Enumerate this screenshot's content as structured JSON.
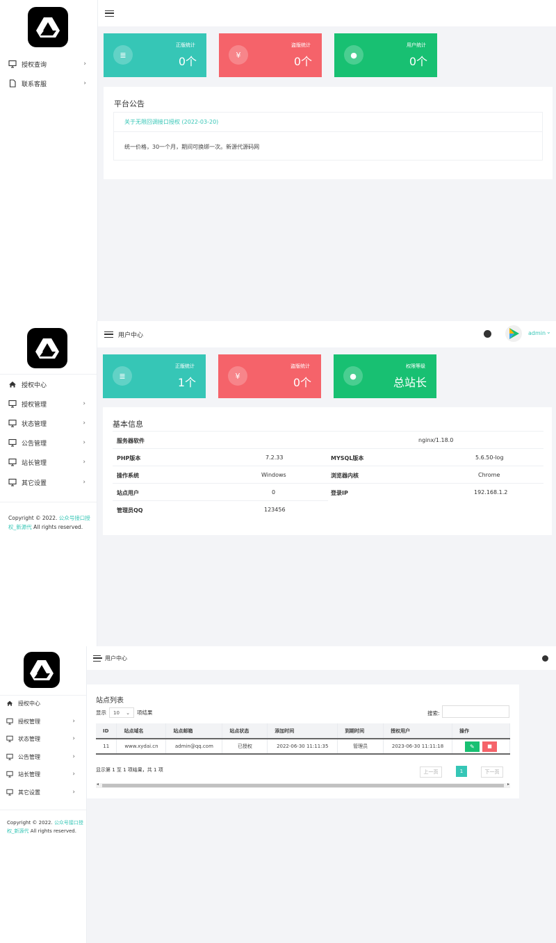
{
  "panel1": {
    "nav": [
      {
        "label": "授权查询",
        "icon": "monitor-icon"
      },
      {
        "label": "联系客服",
        "icon": "file-icon"
      }
    ],
    "cards": [
      {
        "label": "正版统计",
        "value": "0个",
        "icon": "list-icon",
        "color": "#36c6b6"
      },
      {
        "label": "盗版统计",
        "value": "0个",
        "icon": "yen-icon",
        "color": "#f5636a"
      },
      {
        "label": "用户统计",
        "value": "0个",
        "icon": "user-icon",
        "color": "#18c072"
      }
    ],
    "notice_title": "平台公告",
    "notice_link": "关于无限回调接口授权 (2022-03-20)",
    "notice_body": "统一价格，30一个月，期间可换绑一次。新源代源码网"
  },
  "panel2": {
    "header_title": "用户中心",
    "user": "admin",
    "nav": [
      {
        "label": "授权中心",
        "icon": "home-icon"
      },
      {
        "label": "授权管理",
        "icon": "monitor-icon"
      },
      {
        "label": "状态管理",
        "icon": "monitor-icon"
      },
      {
        "label": "公告管理",
        "icon": "monitor-icon"
      },
      {
        "label": "站长管理",
        "icon": "monitor-icon"
      },
      {
        "label": "其它设置",
        "icon": "monitor-icon"
      }
    ],
    "cards": [
      {
        "label": "正版统计",
        "value": "1个",
        "icon": "list-icon"
      },
      {
        "label": "盗版统计",
        "value": "0个",
        "icon": "yen-icon"
      },
      {
        "label": "权限等级",
        "value": "总站长",
        "icon": "user-icon"
      }
    ],
    "info_title": "基本信息",
    "server_label": "服务器软件",
    "server_value": "nginx/1.18.0",
    "rows": [
      {
        "k1": "PHP版本",
        "v1": "7.2.33",
        "k2": "MYSQL版本",
        "v2": "5.6.50-log"
      },
      {
        "k1": "操作系统",
        "v1": "Windows",
        "k2": "浏览器内核",
        "v2": "Chrome"
      },
      {
        "k1": "站点用户",
        "v1": "0",
        "k2": "登录IP",
        "v2": "192.168.1.2"
      },
      {
        "k1": "管理员QQ",
        "v1": "123456",
        "k2": "",
        "v2": ""
      }
    ],
    "footer_prefix": "Copyright © 2022.",
    "footer_link": "公众号接口授权_新源代",
    "footer_suffix": "All rights reserved."
  },
  "panel3": {
    "header_title": "用户中心",
    "nav": [
      {
        "label": "授权中心"
      },
      {
        "label": "授权管理"
      },
      {
        "label": "状态管理"
      },
      {
        "label": "公告管理"
      },
      {
        "label": "站长管理"
      },
      {
        "label": "其它设置"
      }
    ],
    "list_title": "站点列表",
    "show_label": "显示",
    "show_value": "10",
    "show_suffix": "项结果",
    "search_label": "搜索:",
    "columns": [
      "ID",
      "站点域名",
      "站点邮箱",
      "站点状态",
      "添加时间",
      "到期时间",
      "授权用户",
      "操作"
    ],
    "row": [
      "11",
      "www.xydai.cn",
      "admin@qq.com",
      "已授权",
      "2022-06-30 11:11:35",
      "管理员",
      "2023-06-30 11:11:18"
    ],
    "summary": "显示第 1 至 1 项结果，共 1 项",
    "prev": "上一页",
    "page": "1",
    "next": "下一页",
    "footer_prefix": "Copyright © 2022.",
    "footer_link": "公众号接口授权_新源代",
    "footer_suffix": "All rights reserved."
  }
}
